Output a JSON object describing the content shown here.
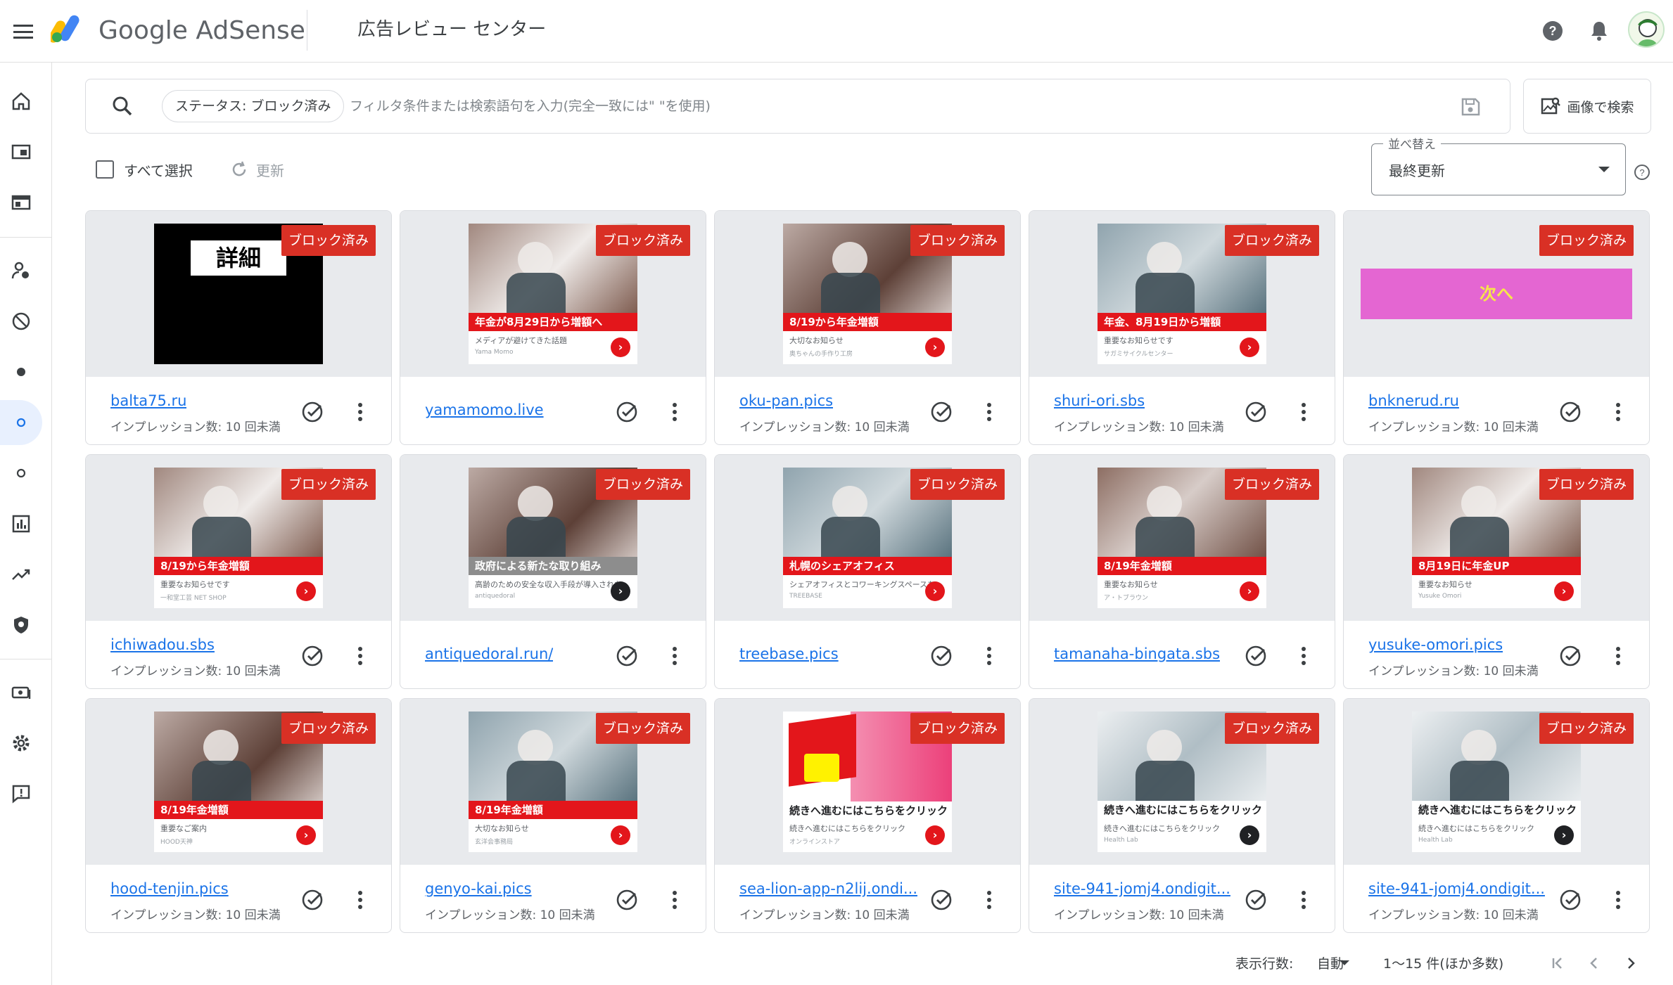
{
  "header": {
    "product_name": "Google AdSense",
    "page_title": "広告レビュー センター"
  },
  "search": {
    "chip_label": "ステータス: ブロック済み",
    "placeholder": "フィルタ条件または検索語句を入力(完全一致には\" \"を使用)",
    "image_search_label": "画像で検索"
  },
  "toolbar": {
    "select_all_label": "すべて選択",
    "refresh_label": "更新"
  },
  "sort": {
    "label": "並べ替え",
    "value": "最終更新"
  },
  "ads": [
    {
      "domain": "balta75.ru",
      "impressions": "インプレッション数: 10 回未満",
      "status": "ブロック済み",
      "creative": "black",
      "headline": "詳細"
    },
    {
      "domain": "yamamomo.live",
      "impressions": "",
      "status": "ブロック済み",
      "creative": "photo",
      "headline": "年金が8月29日から増額へ",
      "sub": "メディアが避けてきた話題",
      "sub2": "Yama Momo"
    },
    {
      "domain": "oku-pan.pics",
      "impressions": "インプレッション数: 10 回未満",
      "status": "ブロック済み",
      "creative": "photo",
      "headline": "8/19から年金増額",
      "sub": "大切なお知らせ",
      "sub2": "奥ちゃんの手作り工房"
    },
    {
      "domain": "shuri-ori.sbs",
      "impressions": "インプレッション数: 10 回未満",
      "status": "ブロック済み",
      "creative": "photo",
      "headline": "年金、8月19日から増額",
      "sub": "重要なお知らせです",
      "sub2": "サガミサイクルセンター"
    },
    {
      "domain": "bnknerud.ru",
      "impressions": "インプレッション数: 10 回未満",
      "status": "ブロック済み",
      "creative": "wide",
      "headline": "次へ"
    },
    {
      "domain": "ichiwadou.sbs",
      "impressions": "インプレッション数: 10 回未満",
      "status": "ブロック済み",
      "creative": "photo",
      "headline": "8/19から年金増額",
      "sub": "重要なお知らせです",
      "sub2": "一和堂工芸 NET SHOP"
    },
    {
      "domain": "antiquedoral.run/",
      "impressions": "",
      "status": "ブロック済み",
      "creative": "photo-dark",
      "headline": "政府による新たな取り組み",
      "sub": "高齢のための安全な収入手段が導入された",
      "sub2": "antiquedoral"
    },
    {
      "domain": "treebase.pics",
      "impressions": "",
      "status": "ブロック済み",
      "creative": "photo",
      "headline": "札幌のシェアオフィス",
      "sub": "シェアオフィスとコワーキングスペースを",
      "sub2": "TREEBASE"
    },
    {
      "domain": "tamanaha-bingata.sbs",
      "impressions": "",
      "status": "ブロック済み",
      "creative": "photo",
      "headline": "8/19年金増額",
      "sub": "重要なお知らせ",
      "sub2": "ア・トブラウン"
    },
    {
      "domain": "yusuke-omori.pics",
      "impressions": "インプレッション数: 10 回未満",
      "status": "ブロック済み",
      "creative": "photo",
      "headline": "8月19日に年金UP",
      "sub": "重要なお知らせ",
      "sub2": "Yusuke Omori"
    },
    {
      "domain": "hood-tenjin.pics",
      "impressions": "インプレッション数: 10 回未満",
      "status": "ブロック済み",
      "creative": "photo",
      "headline": "8/19年金増額",
      "sub": "重要なご案内",
      "sub2": "HOOD天神"
    },
    {
      "domain": "genyo-kai.pics",
      "impressions": "インプレッション数: 10 回未満",
      "status": "ブロック済み",
      "creative": "photo",
      "headline": "8/19年金増額",
      "sub": "大切なお知らせ",
      "sub2": "玄洋会事務局"
    },
    {
      "domain": "sea-lion-app-n2lij.ondi...",
      "impressions": "インプレッション数: 10 回未満",
      "status": "ブロック済み",
      "creative": "sale",
      "headline": "続きへ進むにはこちらをクリック",
      "sub": "続きへ進むにはこちらをクリック",
      "sub2": "オンラインストア"
    },
    {
      "domain": "site-941-jomj4.ondigit...",
      "impressions": "インプレッション数: 10 回未満",
      "status": "ブロック済み",
      "creative": "photo-dark-white",
      "headline": "続きへ進むにはこちらをクリック",
      "sub": "続きへ進むにはこちらをクリック",
      "sub2": "Health Lab"
    },
    {
      "domain": "site-941-jomj4.ondigit...",
      "impressions": "インプレッション数: 10 回未満",
      "status": "ブロック済み",
      "creative": "photo-dark-white",
      "headline": "続きへ進むにはこちらをクリック",
      "sub": "続きへ進むにはこちらをクリック",
      "sub2": "Health Lab"
    }
  ],
  "footer": {
    "rows_label": "表示行数:",
    "rows_value": "自動",
    "range": "1～15 件(ほか多数)"
  },
  "colors": {
    "accent": "#1a73e8",
    "blocked_badge": "#d93025",
    "card_preview_bg": "#e8eaed",
    "wide_ad_bg": "#e466d2"
  }
}
